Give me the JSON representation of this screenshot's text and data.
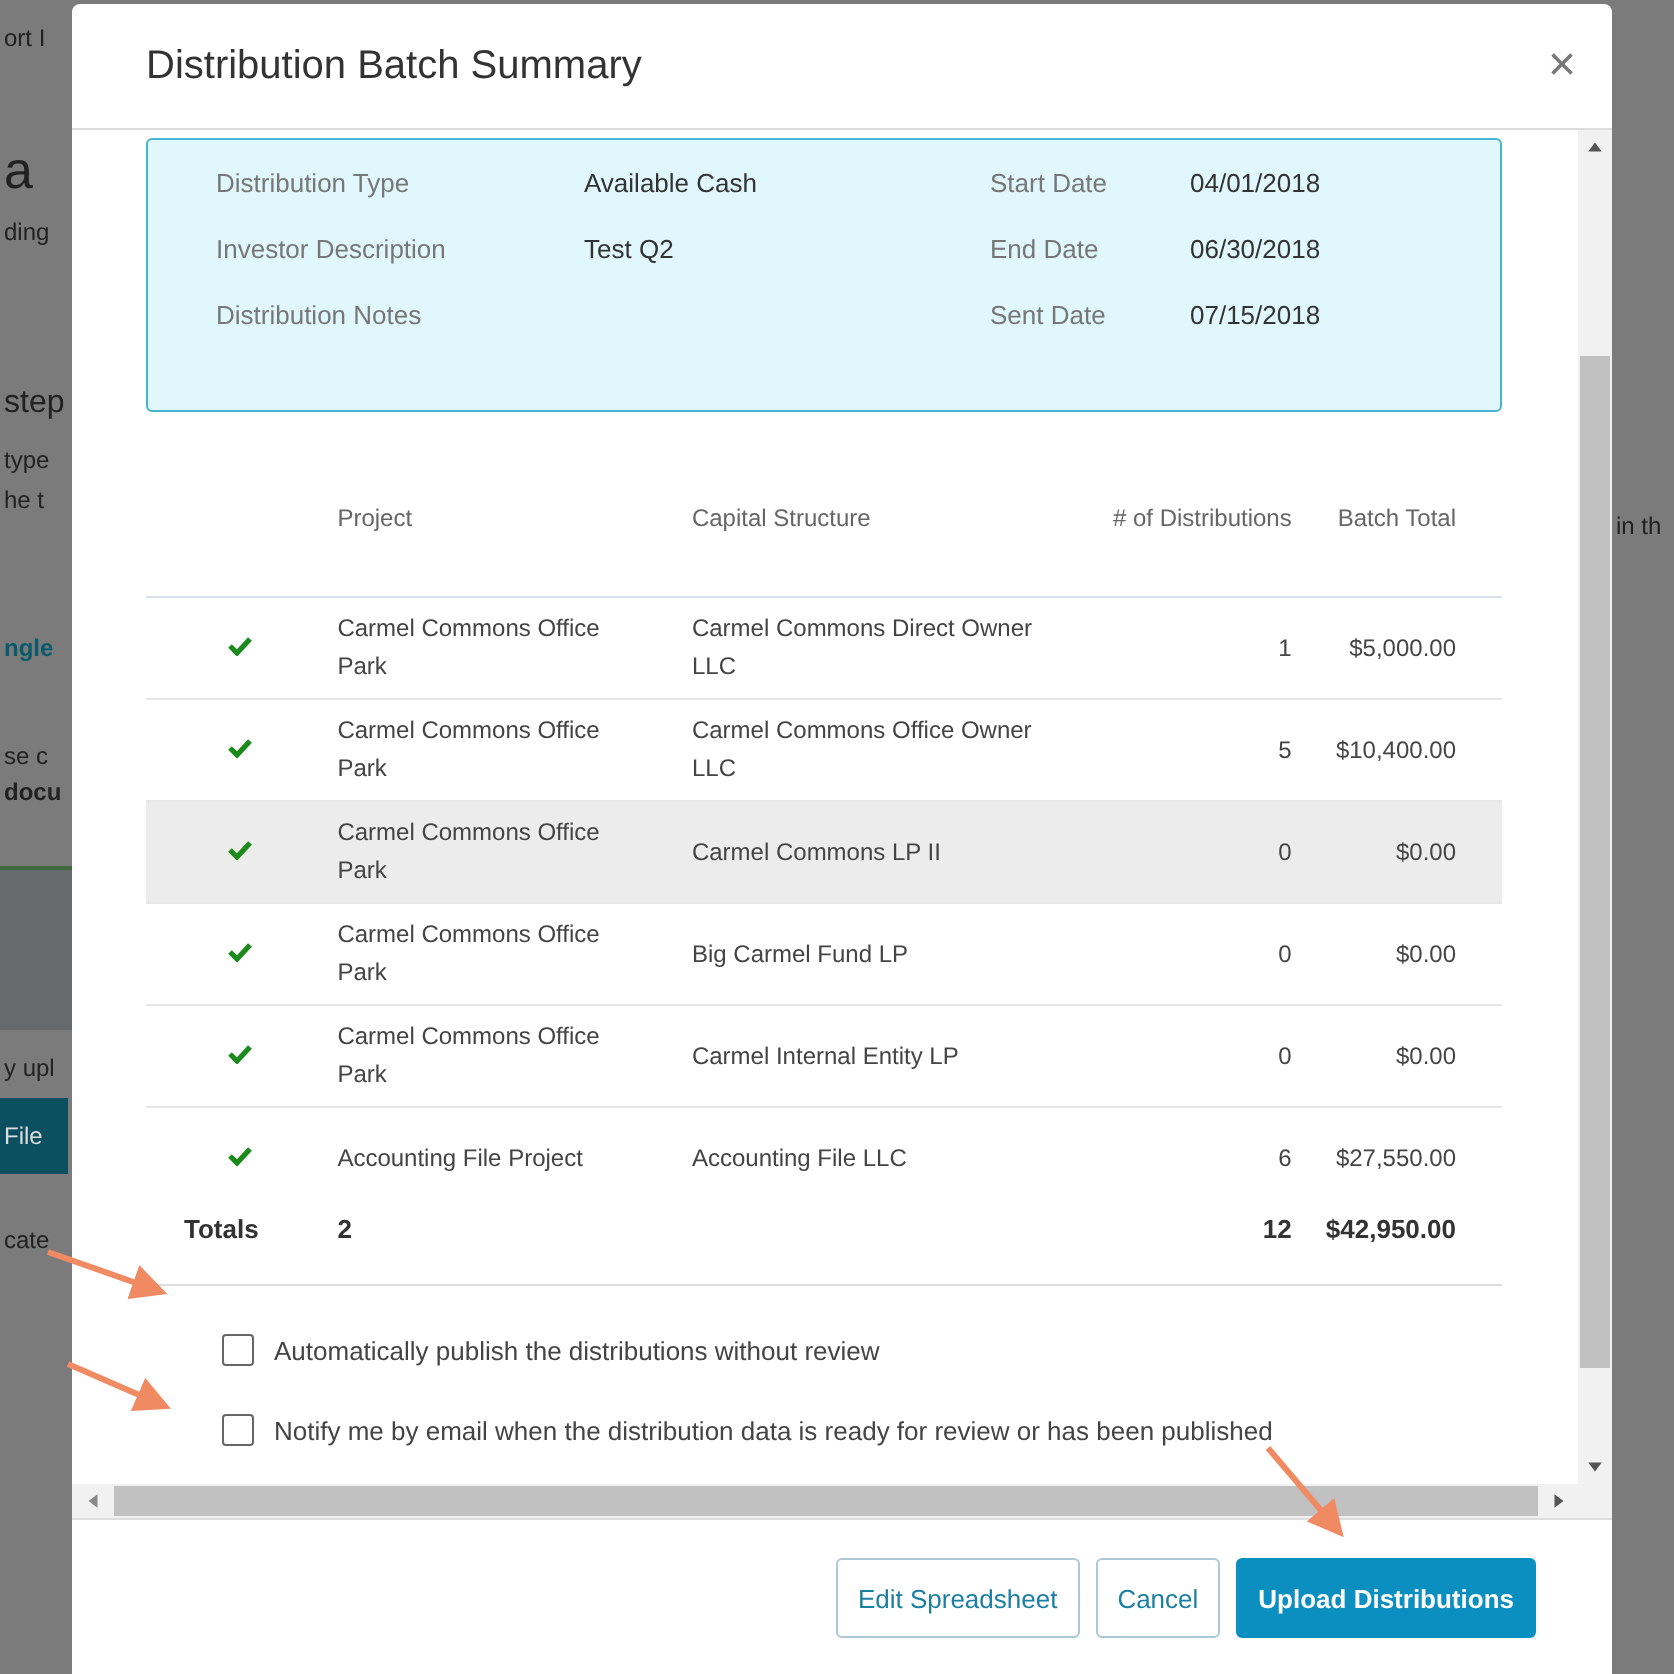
{
  "background": {
    "left": [
      {
        "kind": "text",
        "text": "ort I"
      },
      {
        "kind": "heading",
        "text": "a"
      },
      {
        "kind": "text",
        "text": "ding"
      },
      {
        "kind": "subheading",
        "text": "step"
      },
      {
        "kind": "text",
        "text": "type"
      },
      {
        "kind": "text",
        "text": "he t"
      },
      {
        "kind": "link",
        "text": "ngle"
      },
      {
        "kind": "text",
        "text": "se c"
      },
      {
        "kind": "bold",
        "text": "docu"
      },
      {
        "kind": "thumbnail"
      },
      {
        "kind": "text",
        "text": "y upl"
      },
      {
        "kind": "button",
        "text": "File"
      },
      {
        "kind": "text",
        "text": "cate"
      }
    ],
    "right": [
      {
        "kind": "text",
        "text": "in th"
      }
    ]
  },
  "modal": {
    "title": "Distribution Batch Summary",
    "close": "×",
    "summary": {
      "left": [
        {
          "label": "Distribution Type",
          "value": "Available Cash"
        },
        {
          "label": "Investor Description",
          "value": "Test Q2"
        },
        {
          "label": "Distribution Notes"
        }
      ],
      "right": [
        {
          "label": "Start Date",
          "value": "04/01/2018"
        },
        {
          "label": "End Date",
          "value": "06/30/2018"
        },
        {
          "label": "Sent Date",
          "value": "07/15/2018"
        }
      ]
    },
    "table": {
      "columns": [
        "Project",
        "Capital Structure",
        "# of Distributions",
        "Batch Total"
      ],
      "rows": [
        {
          "ok": true,
          "hovered": false,
          "project": "Carmel Commons Office Park",
          "structure": "Carmel Commons Direct Owner LLC",
          "count": "1",
          "total": "$5,000.00"
        },
        {
          "ok": true,
          "hovered": false,
          "project": "Carmel Commons Office Park",
          "structure": "Carmel Commons Office Owner LLC",
          "count": "5",
          "total": "$10,400.00"
        },
        {
          "ok": true,
          "hovered": true,
          "project": "Carmel Commons Office Park",
          "structure": "Carmel Commons LP II",
          "count": "0",
          "total": "$0.00"
        },
        {
          "ok": true,
          "hovered": false,
          "project": "Carmel Commons Office Park",
          "structure": "Big Carmel Fund LP",
          "count": "0",
          "total": "$0.00"
        },
        {
          "ok": true,
          "hovered": false,
          "project": "Carmel Commons Office Park",
          "structure": "Carmel Internal Entity LP",
          "count": "0",
          "total": "$0.00"
        },
        {
          "ok": true,
          "hovered": false,
          "project": "Accounting File Project",
          "structure": "Accounting File LLC",
          "count": "6",
          "total": "$27,550.00"
        }
      ],
      "totals": {
        "label": "Totals",
        "projects": "2",
        "count": "12",
        "total": "$42,950.00"
      }
    },
    "options": [
      {
        "label": "Automatically publish the distributions without review",
        "checked": false
      },
      {
        "label": "Notify me by email when the distribution data is ready for review or has been published",
        "checked": false
      }
    ],
    "buttons": [
      {
        "label": "Edit Spreadsheet",
        "kind": "default"
      },
      {
        "label": "Cancel",
        "kind": "default"
      },
      {
        "label": "Upload Distributions",
        "kind": "primary"
      }
    ]
  }
}
